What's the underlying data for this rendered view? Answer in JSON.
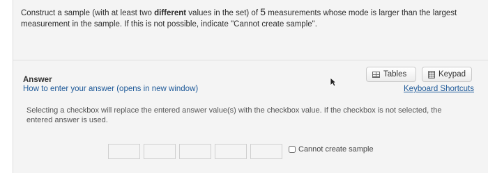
{
  "question": {
    "part1": "Construct a sample (with at least two ",
    "bold": "different",
    "part2": " values in the set) of ",
    "number": "5",
    "part3": " measurements whose mode is larger than the largest measurement in the sample. If this is not possible, indicate \"Cannot create sample\"."
  },
  "answer": {
    "label": "Answer",
    "help_link": "How to enter your answer (opens in new window)"
  },
  "toolbar": {
    "tables_label": "Tables",
    "keypad_label": "Keypad",
    "shortcuts_label": "Keyboard Shortcuts"
  },
  "note": "Selecting a checkbox will replace the entered answer value(s) with the checkbox value. If the checkbox is not selected, the entered answer is used.",
  "inputs": [
    "",
    "",
    "",
    "",
    ""
  ],
  "checkbox": {
    "label": "Cannot create sample",
    "checked": false
  }
}
